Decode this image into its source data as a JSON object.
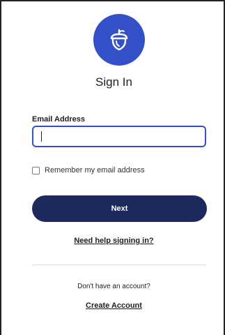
{
  "logo": {
    "icon": "acorn-icon",
    "background_color": "#3350c8",
    "icon_color": "#ffffff"
  },
  "title": "Sign In",
  "email": {
    "label": "Email Address",
    "value": "",
    "placeholder": "",
    "focus_color": "#3350c8"
  },
  "remember": {
    "label": "Remember my email address",
    "checked": false
  },
  "next_button": {
    "label": "Next",
    "color": "#1d2a5e"
  },
  "help_link": "Need help signing in?",
  "footer": {
    "no_account_text": "Don't have an account?",
    "create_account_link": "Create Account"
  }
}
